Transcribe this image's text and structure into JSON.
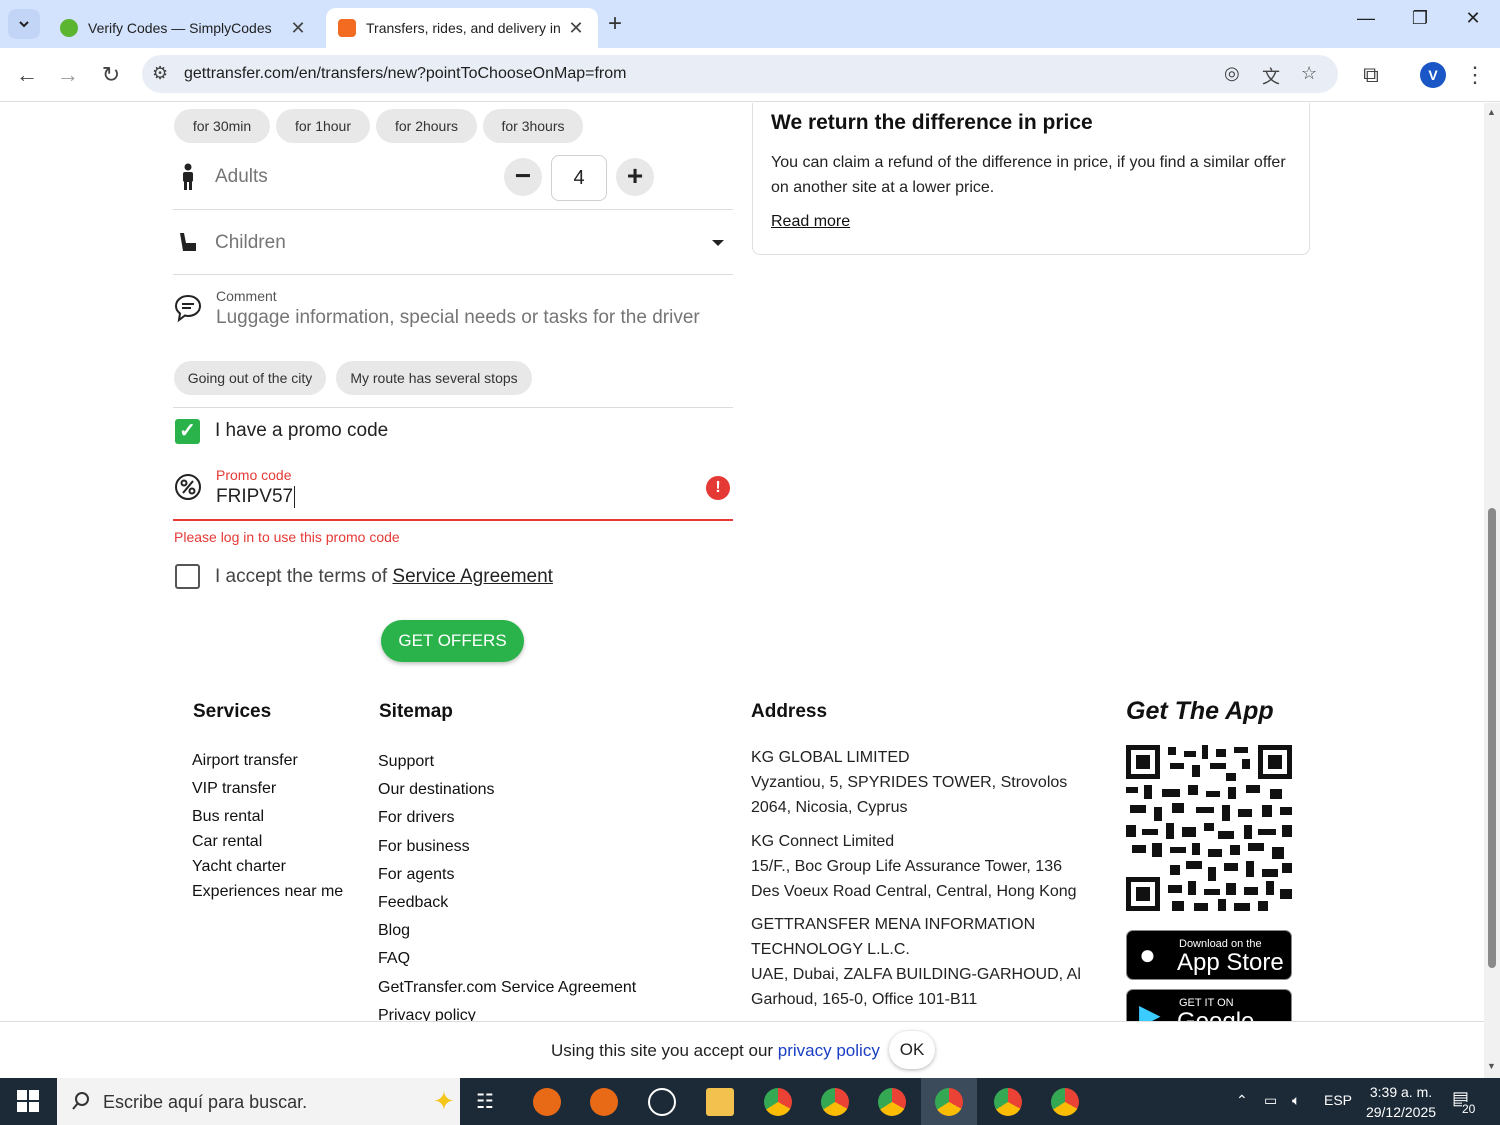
{
  "browser": {
    "tabs": [
      {
        "title": "Verify Codes — SimplyCodes",
        "favicon_color": "#5cb531",
        "active": false
      },
      {
        "title": "Transfers, rides, and delivery in",
        "favicon_color": "#f26b21",
        "active": true
      }
    ],
    "url": "gettransfer.com/en/transfers/new?pointToChooseOnMap=from",
    "profile_initial": "V"
  },
  "form": {
    "duration_chips": [
      "for 30min",
      "for 1hour",
      "for 2hours",
      "for 3hours"
    ],
    "adults": {
      "label": "Adults",
      "value": "4"
    },
    "children": {
      "label": "Children"
    },
    "comment": {
      "label": "Comment",
      "placeholder": "Luggage information, special needs or tasks for the driver"
    },
    "route_chips": [
      "Going out of the city",
      "My route has several stops"
    ],
    "promo_checkbox": {
      "label": "I have a promo code",
      "checked": true
    },
    "promo": {
      "label": "Promo code",
      "value": "FRIPV57",
      "error": "Please log in to use this promo code"
    },
    "terms": {
      "prefix": "I accept the terms of ",
      "link": "Service Agreement",
      "checked": false
    },
    "submit_label": "GET OFFERS"
  },
  "refund_card": {
    "title": "We return the difference in price",
    "text": "You can claim a refund of the difference in price, if you find a similar offer on another site at a lower price.",
    "link": "Read more"
  },
  "footer": {
    "services": {
      "heading": "Services",
      "items": [
        "Airport transfer",
        "VIP transfer",
        "Bus rental",
        "Car rental",
        "Yacht charter",
        "Experiences near me"
      ]
    },
    "sitemap": {
      "heading": "Sitemap",
      "items": [
        "Support",
        "Our destinations",
        "For drivers",
        "For business",
        "For agents",
        "Feedback",
        "Blog",
        "FAQ",
        "GetTransfer.com Service Agreement",
        "Privacy policy"
      ]
    },
    "address": {
      "heading": "Address",
      "blocks": [
        {
          "name": "KG GLOBAL LIMITED",
          "lines": [
            "Vyzantiou, 5, SPYRIDES TOWER, Strovolos",
            "2064, Nicosia, Cyprus"
          ]
        },
        {
          "name": "KG Connect Limited",
          "lines": [
            "15/F., Boc Group Life Assurance Tower, 136",
            "Des Voeux Road Central, Central, Hong Kong"
          ]
        },
        {
          "name": "GETTRANSFER MENA INFORMATION",
          "lines": [
            "TECHNOLOGY L.L.C.",
            "UAE, Dubai, ZALFA BUILDING-GARHOUD, Al",
            "Garhoud, 165-0, Office 101-B11"
          ]
        }
      ]
    },
    "app": {
      "heading": "Get The App",
      "appstore_small": "Download on the",
      "appstore_big": "App Store",
      "googleplay_small": "GET IT ON",
      "googleplay_big": "Google Play"
    }
  },
  "cookie": {
    "text": "Using this site you accept our ",
    "link": "privacy policy",
    "ok": "OK"
  },
  "taskbar": {
    "search_placeholder": "Escribe aquí para buscar.",
    "language": "ESP",
    "time": "3:39 a. m.",
    "date": "29/12/2025",
    "notifications": "20"
  },
  "colors": {
    "accent_green": "#2ab34a",
    "error_red": "#e53935",
    "link_blue": "#1a3fc4"
  }
}
